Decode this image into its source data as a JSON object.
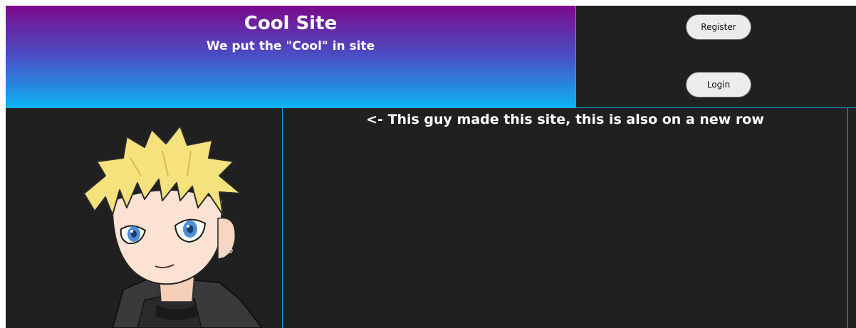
{
  "header": {
    "title": "Cool Site",
    "subtitle": "We put the \"Cool\" in site"
  },
  "auth": {
    "register_label": "Register",
    "login_label": "Login"
  },
  "main": {
    "row_note": "<- This guy made this site, this is also on a new row"
  },
  "colors": {
    "header_gradient_top": "#7b0a8a",
    "header_gradient_bottom": "#0db3f5",
    "panel_background": "#202020",
    "border_accent": "#1aa9e0"
  }
}
